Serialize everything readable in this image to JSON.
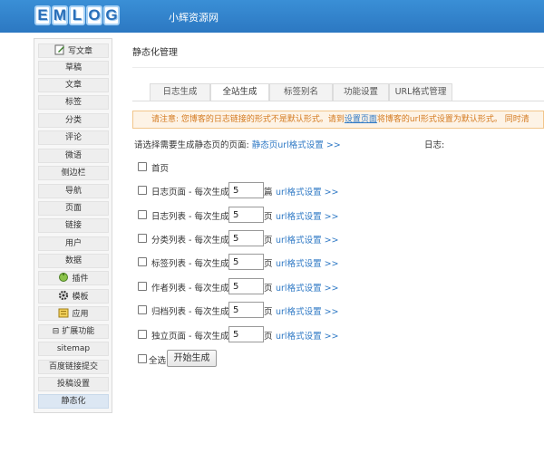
{
  "header": {
    "logo_letters": [
      "E",
      "M",
      "L",
      "O",
      "G"
    ],
    "site_name": "小辉资源网",
    "colors": {
      "bar": "#2f80c9"
    }
  },
  "sidebar": {
    "items": [
      {
        "label": "写文章",
        "icon": "edit-icon"
      },
      {
        "label": "草稿"
      },
      {
        "label": "文章"
      },
      {
        "label": "标签"
      },
      {
        "label": "分类"
      },
      {
        "label": "评论"
      },
      {
        "label": "微语"
      },
      {
        "label": "侧边栏"
      },
      {
        "label": "导航"
      },
      {
        "label": "页面"
      },
      {
        "label": "链接"
      },
      {
        "label": "用户"
      },
      {
        "label": "数据"
      },
      {
        "label": "插件",
        "icon": "plugin-icon"
      },
      {
        "label": "模板",
        "icon": "gear-icon"
      },
      {
        "label": "应用",
        "icon": "app-icon"
      },
      {
        "label": "扩展功能",
        "prefix": "⊟"
      },
      {
        "label": "sitemap"
      },
      {
        "label": "百度链接提交"
      },
      {
        "label": "投稿设置"
      },
      {
        "label": "静态化",
        "active": true
      }
    ]
  },
  "page": {
    "title": "静态化管理",
    "tabs": [
      "日志生成",
      "全站生成",
      "标签别名",
      "功能设置",
      "URL格式管理"
    ],
    "active_tab": "全站生成",
    "notice": {
      "before": "请注意: 您博客的日志链接的形式不是默认形式。请到",
      "link": "设置页面",
      "after": "将博客的url形式设置为默认形式。 同时清"
    },
    "prompt": "请选择需要生成静态页的页面:",
    "prompt_link": "静态页url格式设置 >>",
    "log_label": "日志:",
    "home_label": "首页",
    "rows": [
      {
        "label": "日志页面 - 每次生成",
        "value": "5",
        "unit": "篇",
        "link": "url格式设置 >>"
      },
      {
        "label": "日志列表 - 每次生成",
        "value": "5",
        "unit": "页",
        "link": "url格式设置 >>"
      },
      {
        "label": "分类列表 - 每次生成",
        "value": "5",
        "unit": "页",
        "link": "url格式设置 >>"
      },
      {
        "label": "标签列表 - 每次生成",
        "value": "5",
        "unit": "页",
        "link": "url格式设置 >>"
      },
      {
        "label": "作者列表 - 每次生成",
        "value": "5",
        "unit": "页",
        "link": "url格式设置 >>"
      },
      {
        "label": "归档列表 - 每次生成",
        "value": "5",
        "unit": "页",
        "link": "url格式设置 >>"
      },
      {
        "label": "独立页面 - 每次生成",
        "value": "5",
        "unit": "页",
        "link": "url格式设置 >>"
      }
    ],
    "select_all_label": "全选",
    "start_button": "开始生成"
  }
}
